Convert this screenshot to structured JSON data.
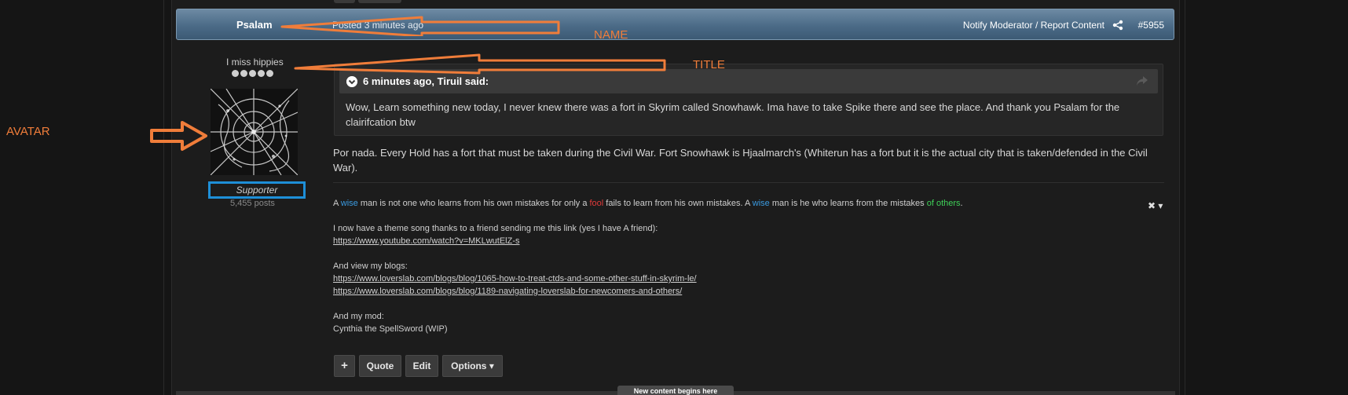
{
  "post": {
    "author": "Psalam",
    "posted": "Posted 3 minutes ago",
    "report": "Notify Moderator / Report Content",
    "number": "#5955"
  },
  "author_panel": {
    "title": "I miss hippies",
    "group": "Supporter",
    "post_count": "5,455 posts"
  },
  "quote": {
    "citation": "6 minutes ago, Tiruil said:",
    "text": "Wow, Learn something new today, I never knew there was a fort in Skyrim called Snowhawk. Ima have to take Spike there and see the place. And thank you Psalam for the clairifcation btw"
  },
  "body": "Por nada. Every Hold has a fort that must be taken during the Civil War. Fort Snowhawk is Hjaalmarch's (Whiterun has a fort but it is the actual city that is taken/defended in the Civil War).",
  "signature": {
    "line1_a": "A ",
    "line1_wise1": "wise",
    "line1_b": " man is not one who learns from his own mistakes for only a ",
    "line1_fool": "fool",
    "line1_c": " fails to learn from his own mistakes. A ",
    "line1_wise2": "wise",
    "line1_d": " man is he who learns from the mistakes ",
    "line1_others": "of others",
    "line1_e": ".",
    "theme_intro": "I now have a theme song thanks to a friend sending me this link (yes I have A friend):",
    "youtube_link": "https://www.youtube.com/watch?v=MKLwutElZ-s",
    "blogs_intro": "And view my blogs:",
    "blog_link_1": "https://www.loverslab.com/blogs/blog/1065-how-to-treat-ctds-and-some-other-stuff-in-skyrim-le/",
    "blog_link_2": "https://www.loverslab.com/blogs/blog/1189-navigating-loverslab-for-newcomers-and-others/",
    "mod_intro": "And my mod:",
    "mod_name": "Cynthia the SpellSword (WIP)"
  },
  "sig_tools": "✖ ▾",
  "buttons": {
    "plus": "+",
    "quote": "Quote",
    "edit": "Edit",
    "options": "Options ▾"
  },
  "new_content": "New content begins here",
  "annotations": {
    "name": "NAME",
    "title": "TITLE",
    "avatar": "AVATAR"
  },
  "colors": {
    "header_blue": "#4b6b87",
    "annotation_orange": "#f07d3a",
    "badge_blue": "#1e8fd8",
    "wise_blue": "#3a9ae0",
    "fool_red": "#e03a3a",
    "others_green": "#3fcf58"
  }
}
